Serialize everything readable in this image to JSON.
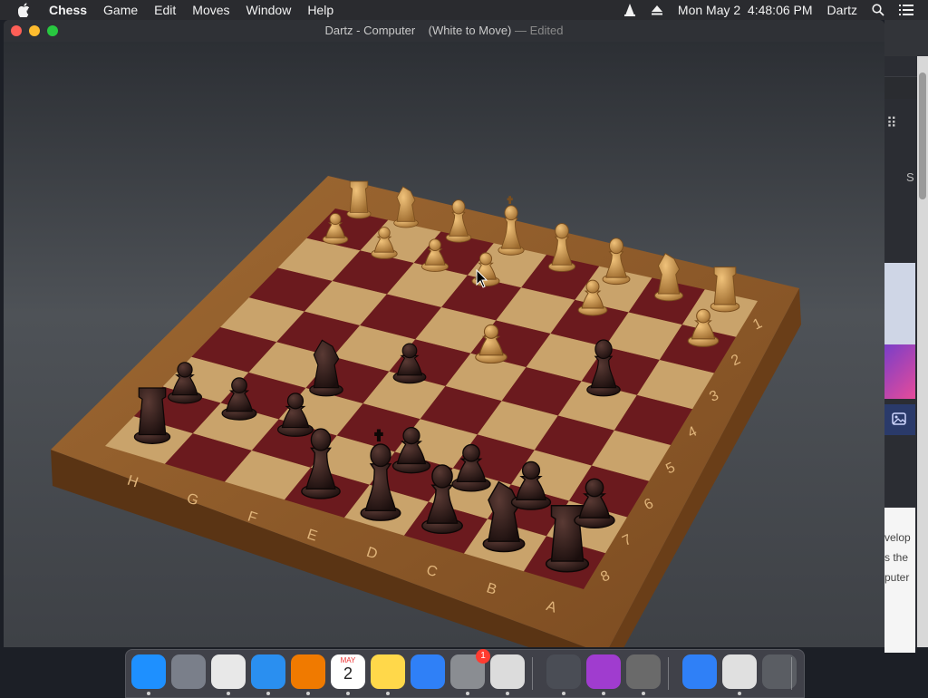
{
  "menubar": {
    "apple": "apple-logo-icon",
    "app_name": "Chess",
    "items": [
      "Game",
      "Edit",
      "Moves",
      "Window",
      "Help"
    ],
    "clock": "Mon May 2  4:48:06 PM",
    "user": "Dartz",
    "icons": [
      "vlc-icon",
      "eject-icon",
      "search-icon",
      "list-icon"
    ]
  },
  "window": {
    "title": "Dartz - Computer",
    "status": "(White to Move)",
    "edited": "— Edited"
  },
  "board": {
    "file_labels": [
      "H",
      "G",
      "F",
      "E",
      "D",
      "C",
      "B",
      "A"
    ],
    "rank_labels": [
      "1",
      "2",
      "3",
      "4",
      "5",
      "6",
      "7",
      "8"
    ],
    "colors": {
      "frame": "#8a5a2b",
      "light_square": "#c9a36b",
      "dark_square": "#6b1a1e",
      "white_piece": "#c8944a",
      "black_piece": "#2a1816"
    }
  },
  "background_window": {
    "text_lines": [
      "velop",
      "s the",
      "puter"
    ],
    "s_letter": "S"
  },
  "dock": {
    "items": [
      {
        "name": "finder",
        "color": "#1e90ff"
      },
      {
        "name": "launchpad",
        "color": "#7a7f8a"
      },
      {
        "name": "chrome",
        "color": "#e8e8e8"
      },
      {
        "name": "safari",
        "color": "#2a8ff0"
      },
      {
        "name": "vlc",
        "color": "#f07a00"
      },
      {
        "name": "calendar",
        "color": "#ffffff",
        "month": "MAY",
        "day": "2"
      },
      {
        "name": "notes",
        "color": "#ffd84a"
      },
      {
        "name": "app-store",
        "color": "#2f80f7"
      },
      {
        "name": "system-preferences",
        "color": "#8a8d92",
        "badge": "1"
      },
      {
        "name": "roblox",
        "color": "#dcdcdc"
      },
      {
        "name": "compass-tool",
        "color": "#4a4d55"
      },
      {
        "name": "downloader",
        "color": "#a03ccf"
      },
      {
        "name": "chess",
        "color": "#6a6a6a"
      },
      {
        "name": "app-store-2",
        "color": "#2f80f7"
      },
      {
        "name": "document",
        "color": "#e0e0e0"
      },
      {
        "name": "trash",
        "color": "#5a5d63"
      }
    ]
  }
}
